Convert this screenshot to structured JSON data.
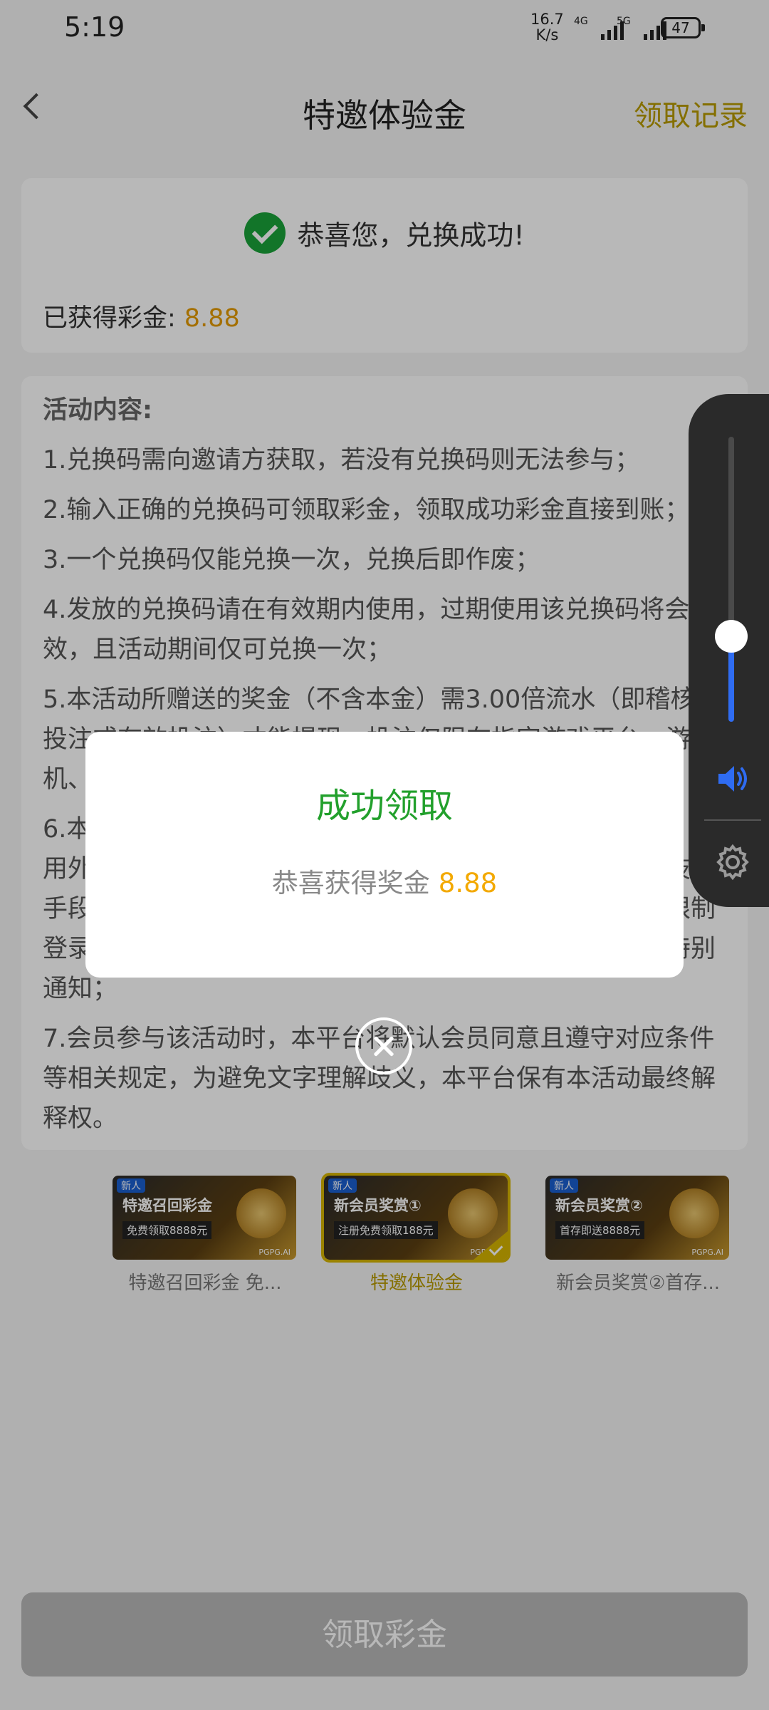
{
  "status_bar": {
    "time": "5:19",
    "net_speed_value": "16.7",
    "net_speed_unit": "K/s",
    "signal1_label": "4G",
    "signal2_label": "5G",
    "battery": "47"
  },
  "header": {
    "title": "特邀体验金",
    "action": "领取记录"
  },
  "success_card": {
    "message": "恭喜您，兑换成功!",
    "earned_label": "已获得彩金:",
    "earned_amount": "8.88"
  },
  "rules": {
    "heading": "活动内容:",
    "items": [
      "1.兑换码需向邀请方获取，若没有兑换码则无法参与；",
      "2.输入正确的兑换码可领取彩金，领取成功彩金直接到账；",
      "3.一个兑换码仅能兑换一次，兑换后即作废；",
      "4.发放的兑换码请在有效期内使用，过期使用该兑换码将会失效，且活动期间仅可兑换一次；",
      "5.本活动所赠送的奖金（不含本金）需3.00倍流水（即稽核、投注或有效投注）才能提现，投注仅限在指定游戏平台、游戏机、",
      "6.本活动仅限账号本人进行正常游戏使用，禁止租借账号、使用外挂、机器人、不同账号对赌、互刷、套利、使用其他技术手段等，一经发现将取消或扣除收益、冻结或封禁账号、限制登录、不进行提款等处理，本平台保留最终解释权，无需特别通知；",
      "7.会员参与该活动时，本平台将默认会员同意且遵守对应条件等相关规定，为避免文字理解歧义，本平台保有本活动最终解释权。"
    ]
  },
  "promos": [
    {
      "tag": "新人",
      "banner_title": "特邀召回彩金",
      "banner_sub": "免费领取8888元",
      "watermark": "PGPG.AI",
      "caption": "特邀召回彩金 免...",
      "active": false
    },
    {
      "tag": "新人",
      "banner_title": "新会员奖赏①",
      "banner_sub": "注册免费领取188元",
      "watermark": "PGPG.AI",
      "caption": "特邀体验金",
      "active": true
    },
    {
      "tag": "新人",
      "banner_title": "新会员奖赏②",
      "banner_sub": "首存即送8888元",
      "watermark": "PGPG.AI",
      "caption": "新会员奖赏②首存...",
      "active": false
    }
  ],
  "bottom": {
    "button_label": "领取彩金"
  },
  "modal": {
    "title": "成功领取",
    "message": "恭喜获得奖金",
    "bonus": "8.88"
  },
  "volume_panel": {
    "level": 0.3,
    "icons": [
      "speaker-icon",
      "gear-icon"
    ]
  },
  "colors": {
    "accent_gold": "#b89a00",
    "amount_orange": "#e39a00",
    "success_green": "#22a02c",
    "volume_blue": "#2f6cf2"
  }
}
